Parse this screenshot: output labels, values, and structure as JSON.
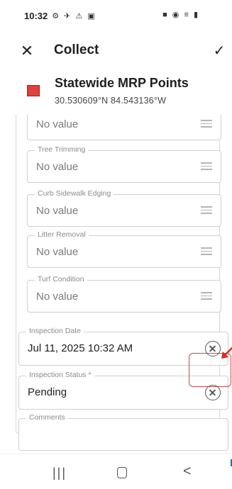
{
  "status_bar": {
    "time": "10:32",
    "left_icons": "⚙ ✈ ⚠ ▣",
    "right_icons": "■ ◉ ≡ ▮"
  },
  "topbar": {
    "close_icon": "close-icon",
    "title": "Collect",
    "confirm_icon": "check-icon"
  },
  "layer": {
    "name": "Statewide MRP Points",
    "coordinates": "30.530609°N 84.543136°W",
    "swatch_color": "#e0413e"
  },
  "fields": [
    {
      "label": "",
      "value": "No value"
    },
    {
      "label": "Tree Trimming",
      "value": "No value"
    },
    {
      "label": "Curb Sidewalk Edging",
      "value": "No value"
    },
    {
      "label": "Litter Removal",
      "value": "No value"
    },
    {
      "label": "Turf Condition",
      "value": "No value"
    }
  ],
  "inspection_date": {
    "label": "Inspection Date",
    "value": "Jul 11, 2025 10:32 AM"
  },
  "inspection_status": {
    "label": "Inspection Status *",
    "value": "Pending"
  },
  "comments": {
    "label": "Comments",
    "value": ""
  },
  "nav": {
    "recents": "|||",
    "back": "<"
  },
  "colors": {
    "highlight": "#c44a4a",
    "arrow": "#e0281d"
  }
}
